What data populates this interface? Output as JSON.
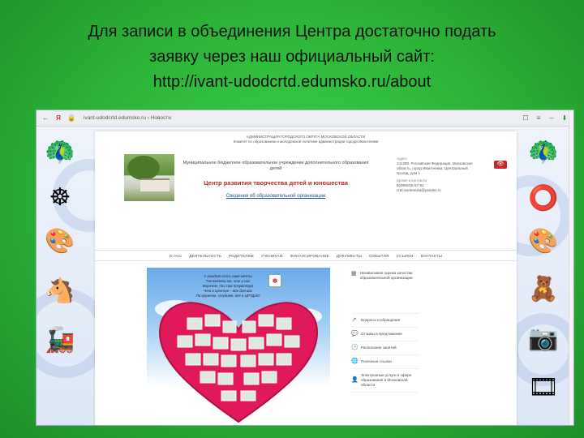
{
  "slide": {
    "title_lines": [
      "Для записи в объединения Центра достаточно  подать",
      "заявку через наш официальный сайт:",
      "http://ivant-udodcrtd.edumsko.ru/about"
    ]
  },
  "browser": {
    "back_icon": "←",
    "yandex_icon": "Я",
    "lock_icon": "🔒",
    "address": "ivant-udodcrtd.edumsko.ru › Новости",
    "bookmark_icon": "☐",
    "menu_icon": "≡",
    "minimize_icon": "–",
    "download_icon": "⬇"
  },
  "site": {
    "ministry_lines": [
      "АДМИНИСТРАЦИЯ ГОРОДСКОГО ОКРУГА МОСКОВСКОЙ ОБЛАСТИ",
      "Комитет по образованию и молодежной политике администрации города Ивантеевки"
    ],
    "org_full_name": "Муниципальное бюджетное образовательное учреждение дополнительного образования детей",
    "org_short_name": "Центр развития творчества детей и юношества",
    "org_link": "Сведения об образовательной организации",
    "contacts": {
      "address_label": "Адрес",
      "address": "141280, Российская Федерация, Московская область, город Ивантеевка, Центральный проезд, дом 1",
      "phone_label": "Время и контакты",
      "phone": "8(49653)6-57-92",
      "email": "crtd.ivanteevka@yandex.ru"
    },
    "eye_icon": "👁",
    "nav": [
      "О НАС",
      "ДЕЯТЕЛЬНОСТЬ",
      "РОДИТЕЛЯМ",
      "УЧЕНИКАМ",
      "ФИНАНСИРОВАНИЕ",
      "ДОКУМЕНТЫ",
      "СОБЫТИЯ",
      "ССЫЛКИ",
      "КОНТАКТЫ"
    ],
    "poster_lines": [
      "У каждого есть своя мечта",
      "Так взгляни же, что у нас",
      "Впрочем, ты сам почувствуй",
      "Что в Центре – все для вас",
      "По кружкам, студиям, всё в ЦРТДиЮ"
    ],
    "poster_logo_icon": "✽",
    "side_head_icon": "▦",
    "side_head_text": "Независимая оценка качества образовательной организации",
    "side_items": [
      {
        "icon": "↗",
        "text": "Вопросы и обращения"
      },
      {
        "icon": "💬",
        "text": "Отзывы и предложения"
      },
      {
        "icon": "🕒",
        "text": "Расписание занятий"
      },
      {
        "icon": "🌐",
        "text": "Полезные ссылки"
      },
      {
        "icon": "👤",
        "text": "Электронные услуги в сфере образования в Московской области"
      }
    ]
  },
  "decor": {
    "left": [
      "🦚",
      "☸",
      "🎨",
      "🐴",
      "🚂"
    ],
    "right": [
      "🦚",
      "⭕",
      "🎨",
      "🧸",
      "📷",
      "🎞"
    ]
  },
  "colors": {
    "slide_green": "#2fb33c",
    "accent_red": "#b5282a",
    "link_blue": "#25507d"
  }
}
